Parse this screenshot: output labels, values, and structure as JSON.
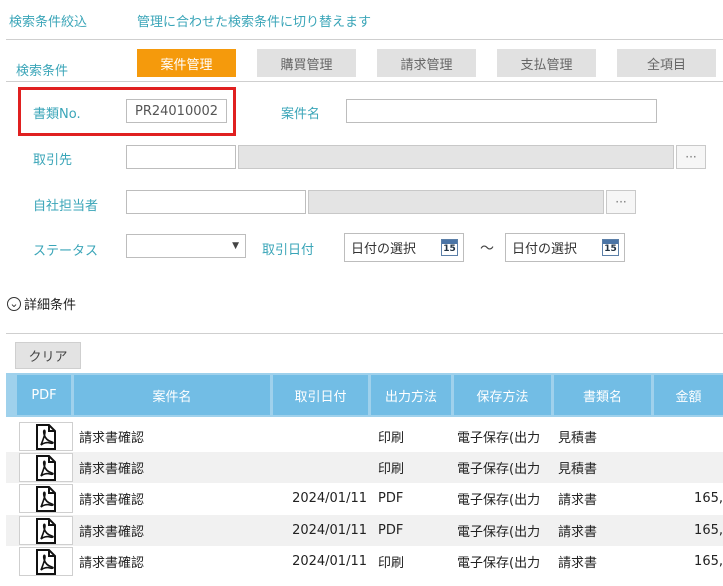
{
  "header": {
    "filter_title": "検索条件絞込",
    "switch_link": "管理に合わせた検索条件に切り替えます"
  },
  "conditions": {
    "label": "検索条件",
    "tabs": [
      {
        "label": "案件管理",
        "active": true
      },
      {
        "label": "購買管理",
        "active": false
      },
      {
        "label": "請求管理",
        "active": false
      },
      {
        "label": "支払管理",
        "active": false
      },
      {
        "label": "全項目",
        "active": false
      }
    ]
  },
  "form": {
    "doc_no_label": "書類No.",
    "doc_no_value": "PR24010002",
    "case_name_label": "案件名",
    "case_name_value": "",
    "client_label": "取引先",
    "staff_label": "自社担当者",
    "status_label": "ステータス",
    "status_value": "",
    "dropdown_arrow": "▼",
    "trade_date_label": "取引日付",
    "date_from_placeholder": "日付の選択",
    "date_to_placeholder": "日付の選択",
    "tilde": "〜",
    "ellipsis": "···",
    "cal_day": "15"
  },
  "details": {
    "icon": "⌄",
    "label": "詳細条件"
  },
  "table": {
    "clear_label": "クリア",
    "columns": [
      "PDF",
      "案件名",
      "取引日付",
      "出力方法",
      "保存方法",
      "書類名",
      "金額"
    ],
    "rows": [
      {
        "name": "請求書確認",
        "date": "",
        "output": "印刷",
        "storage": "電子保存(出力",
        "doc": "見積書",
        "amount": ""
      },
      {
        "name": "請求書確認",
        "date": "",
        "output": "印刷",
        "storage": "電子保存(出力",
        "doc": "見積書",
        "amount": ""
      },
      {
        "name": "請求書確認",
        "date": "2024/01/11",
        "output": "PDF",
        "storage": "電子保存(出力",
        "doc": "請求書",
        "amount": "165,"
      },
      {
        "name": "請求書確認",
        "date": "2024/01/11",
        "output": "PDF",
        "storage": "電子保存(出力",
        "doc": "請求書",
        "amount": "165,"
      },
      {
        "name": "請求書確認",
        "date": "2024/01/11",
        "output": "印刷",
        "storage": "電子保存(出力",
        "doc": "請求書",
        "amount": "165,"
      }
    ]
  },
  "colors": {
    "accent_teal": "#3aa5b8",
    "active_tab": "#f59a0c",
    "header_blue": "#72bde5",
    "highlight_red": "#e02020"
  }
}
